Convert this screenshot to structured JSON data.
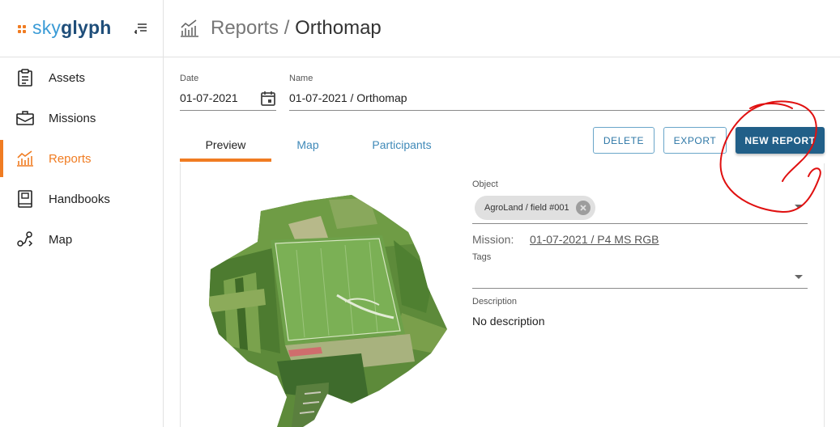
{
  "brand": {
    "sky": "sky",
    "glyph": "glyph",
    "accent": "#f07c22"
  },
  "sidebar": {
    "items": [
      {
        "label": "Assets",
        "icon": "clipboard-icon"
      },
      {
        "label": "Missions",
        "icon": "briefcase-icon"
      },
      {
        "label": "Reports",
        "icon": "chart-icon",
        "active": true
      },
      {
        "label": "Handbooks",
        "icon": "book-icon"
      },
      {
        "label": "Map",
        "icon": "map-route-icon"
      }
    ]
  },
  "header": {
    "section": "Reports",
    "separator": " / ",
    "page": "Orthomap"
  },
  "form": {
    "date_label": "Date",
    "date_value": "01-07-2021",
    "name_label": "Name",
    "name_value": "01-07-2021 / Orthomap"
  },
  "tabs": [
    {
      "label": "Preview",
      "active": true
    },
    {
      "label": "Map"
    },
    {
      "label": "Participants"
    }
  ],
  "actions": {
    "delete": "DELETE",
    "export": "EXPORT",
    "new_report": "NEW REPORT"
  },
  "details": {
    "object_label": "Object",
    "object_chip": "AgroLand / field #001",
    "mission_label": "Mission:",
    "mission_value": "01-07-2021 / P4 MS RGB",
    "tags_label": "Tags",
    "description_label": "Description",
    "description_value": "No description"
  },
  "colors": {
    "primary": "#215f88",
    "link": "#3f89b8",
    "annotation": "#e01010"
  }
}
